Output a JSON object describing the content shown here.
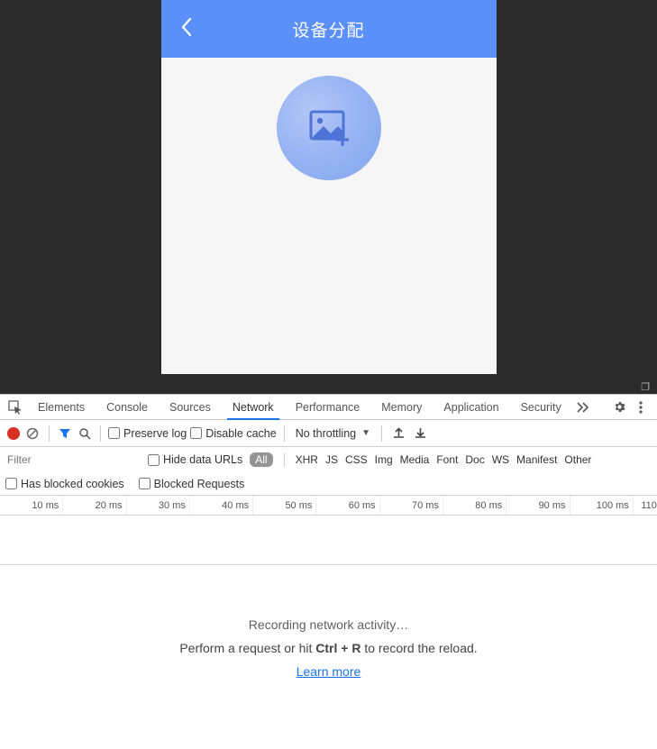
{
  "mobile": {
    "title": "设备分配"
  },
  "devtools": {
    "tabs": {
      "elements": "Elements",
      "console": "Console",
      "sources": "Sources",
      "network": "Network",
      "performance": "Performance",
      "memory": "Memory",
      "application": "Application",
      "security": "Security"
    },
    "toolbar": {
      "preserve_log": "Preserve log",
      "disable_cache": "Disable cache",
      "throttling": "No throttling"
    },
    "filter": {
      "placeholder": "Filter",
      "hide_data_urls": "Hide data URLs",
      "types": {
        "all": "All",
        "xhr": "XHR",
        "js": "JS",
        "css": "CSS",
        "img": "Img",
        "media": "Media",
        "font": "Font",
        "doc": "Doc",
        "ws": "WS",
        "manifest": "Manifest",
        "other": "Other"
      },
      "has_blocked_cookies": "Has blocked cookies",
      "blocked_requests": "Blocked Requests"
    },
    "timeline": [
      "10 ms",
      "20 ms",
      "30 ms",
      "40 ms",
      "50 ms",
      "60 ms",
      "70 ms",
      "80 ms",
      "90 ms",
      "100 ms",
      "110"
    ],
    "empty": {
      "line1": "Recording network activity…",
      "line2_pre": "Perform a request or hit ",
      "line2_key": "Ctrl + R",
      "line2_post": " to record the reload.",
      "learn_more": "Learn more"
    }
  }
}
